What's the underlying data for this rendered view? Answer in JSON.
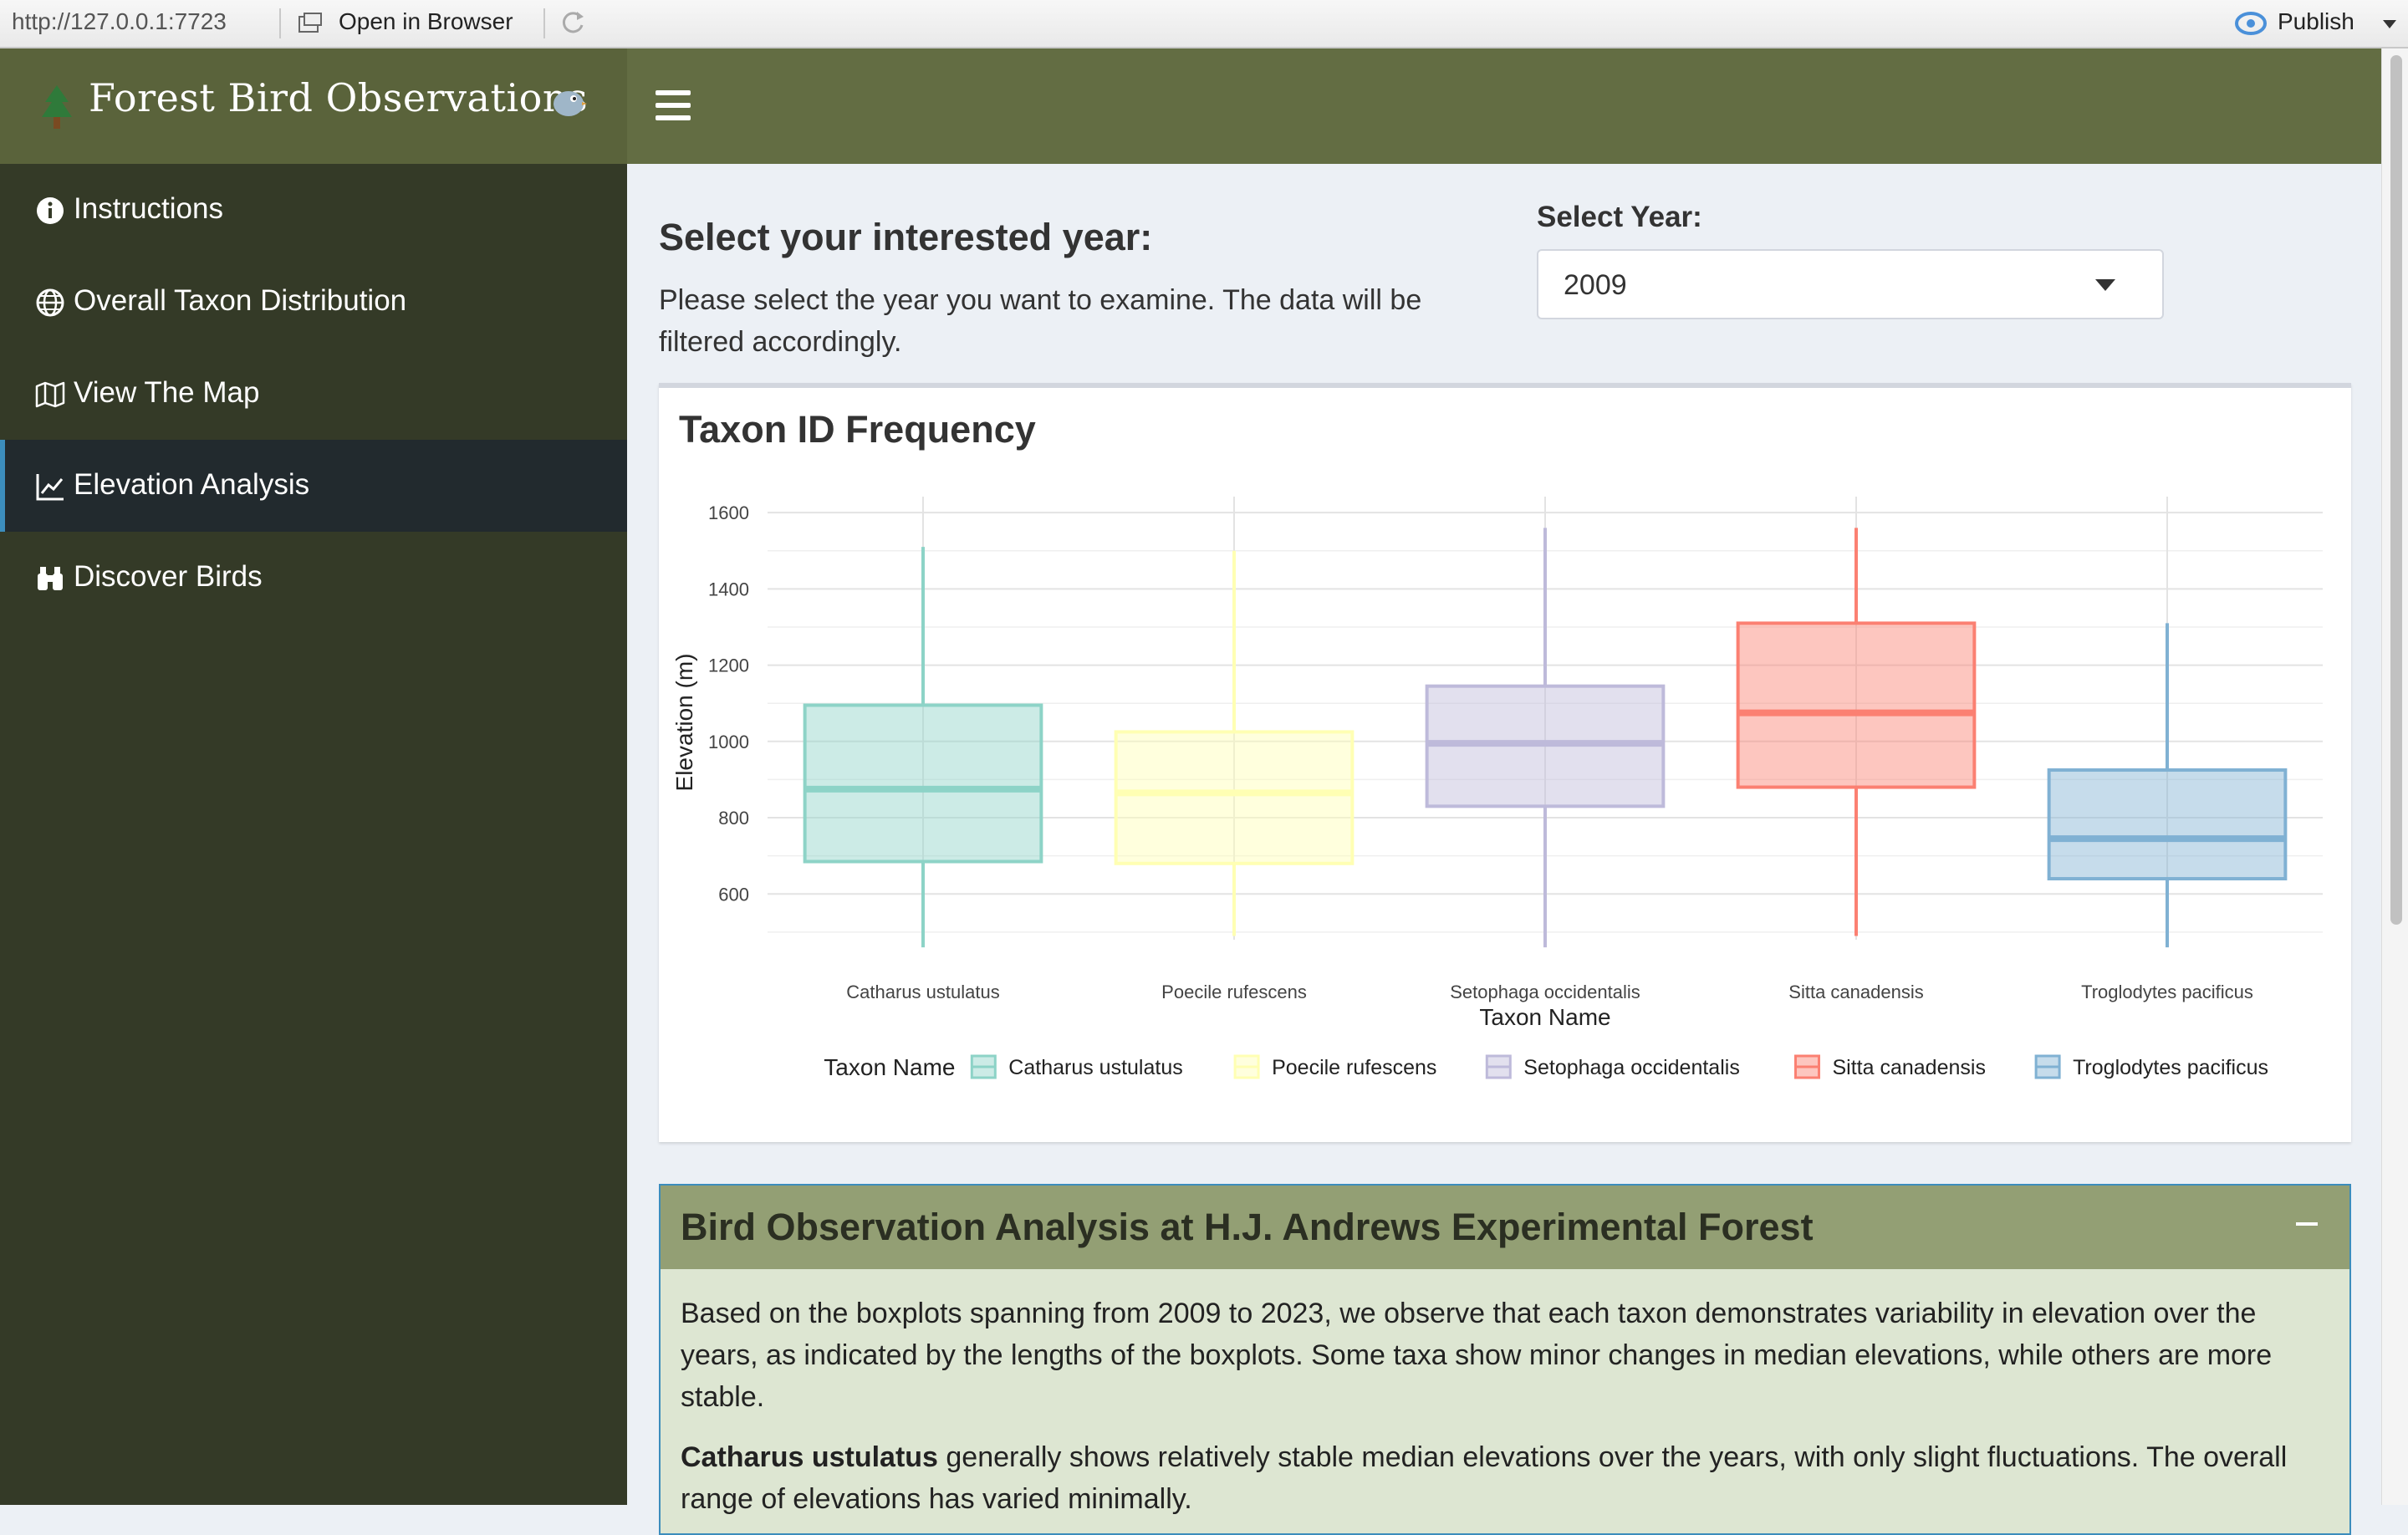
{
  "viewer": {
    "url": "http://127.0.0.1:7723",
    "open_in_browser": "Open in Browser",
    "publish": "Publish"
  },
  "app": {
    "title": "Forest Bird Observations",
    "colors": {
      "header": "#636d43",
      "brand": "#5a633b",
      "sidebar": "#343a27",
      "active": "#222a2e",
      "accent": "#3c8dbc"
    }
  },
  "sidebar": {
    "items": [
      {
        "label": "Instructions",
        "icon": "info-circle-icon",
        "active": false
      },
      {
        "label": "Overall Taxon Distribution",
        "icon": "globe-icon",
        "active": false
      },
      {
        "label": "View The Map",
        "icon": "map-icon",
        "active": false
      },
      {
        "label": "Elevation Analysis",
        "icon": "line-chart-icon",
        "active": true
      },
      {
        "label": "Discover Birds",
        "icon": "binoculars-icon",
        "active": false
      }
    ]
  },
  "main": {
    "heading": "Select your interested year:",
    "description": "Please select the year you want to examine. The data will be filtered accordingly.",
    "year_label": "Select Year:",
    "year_value": "2009"
  },
  "chart_box": {
    "title": "Taxon ID Frequency"
  },
  "chart_data": {
    "type": "boxplot",
    "xlabel": "Taxon Name",
    "ylabel": "Elevation (m)",
    "ylim": [
      480,
      1620
    ],
    "yticks": [
      600,
      800,
      1000,
      1200,
      1400,
      1600
    ],
    "grid": true,
    "legend_title": "Taxon Name",
    "legend_position": "bottom",
    "categories": [
      "Catharus ustulatus",
      "Poecile rufescens",
      "Setophaga occidentalis",
      "Sitta canadensis",
      "Troglodytes pacificus"
    ],
    "series": [
      {
        "name": "Catharus ustulatus",
        "color": "#8dd3c7",
        "min": 460,
        "q1": 685,
        "median": 875,
        "q3": 1095,
        "max": 1510
      },
      {
        "name": "Poecile rufescens",
        "color": "#ffffb3",
        "min": 490,
        "q1": 680,
        "median": 865,
        "q3": 1025,
        "max": 1500
      },
      {
        "name": "Setophaga occidentalis",
        "color": "#bebada",
        "min": 460,
        "q1": 830,
        "median": 995,
        "q3": 1145,
        "max": 1560
      },
      {
        "name": "Sitta canadensis",
        "color": "#fb8072",
        "min": 490,
        "q1": 880,
        "median": 1075,
        "q3": 1310,
        "max": 1560
      },
      {
        "name": "Troglodytes pacificus",
        "color": "#80b1d3",
        "min": 460,
        "q1": 640,
        "median": 745,
        "q3": 925,
        "max": 1310
      }
    ]
  },
  "analysis": {
    "title": "Bird Observation Analysis at H.J. Andrews Experimental Forest",
    "p1": "Based on the boxplots spanning from 2009 to 2023, we observe that each taxon demonstrates variability in elevation over the years, as indicated by the lengths of the boxplots. Some taxa show minor changes in median elevations, while others are more stable.",
    "p2_bold": "Catharus ustulatus",
    "p2_rest": " generally shows relatively stable median elevations over the years, with only slight fluctuations. The overall range of elevations has varied minimally."
  }
}
